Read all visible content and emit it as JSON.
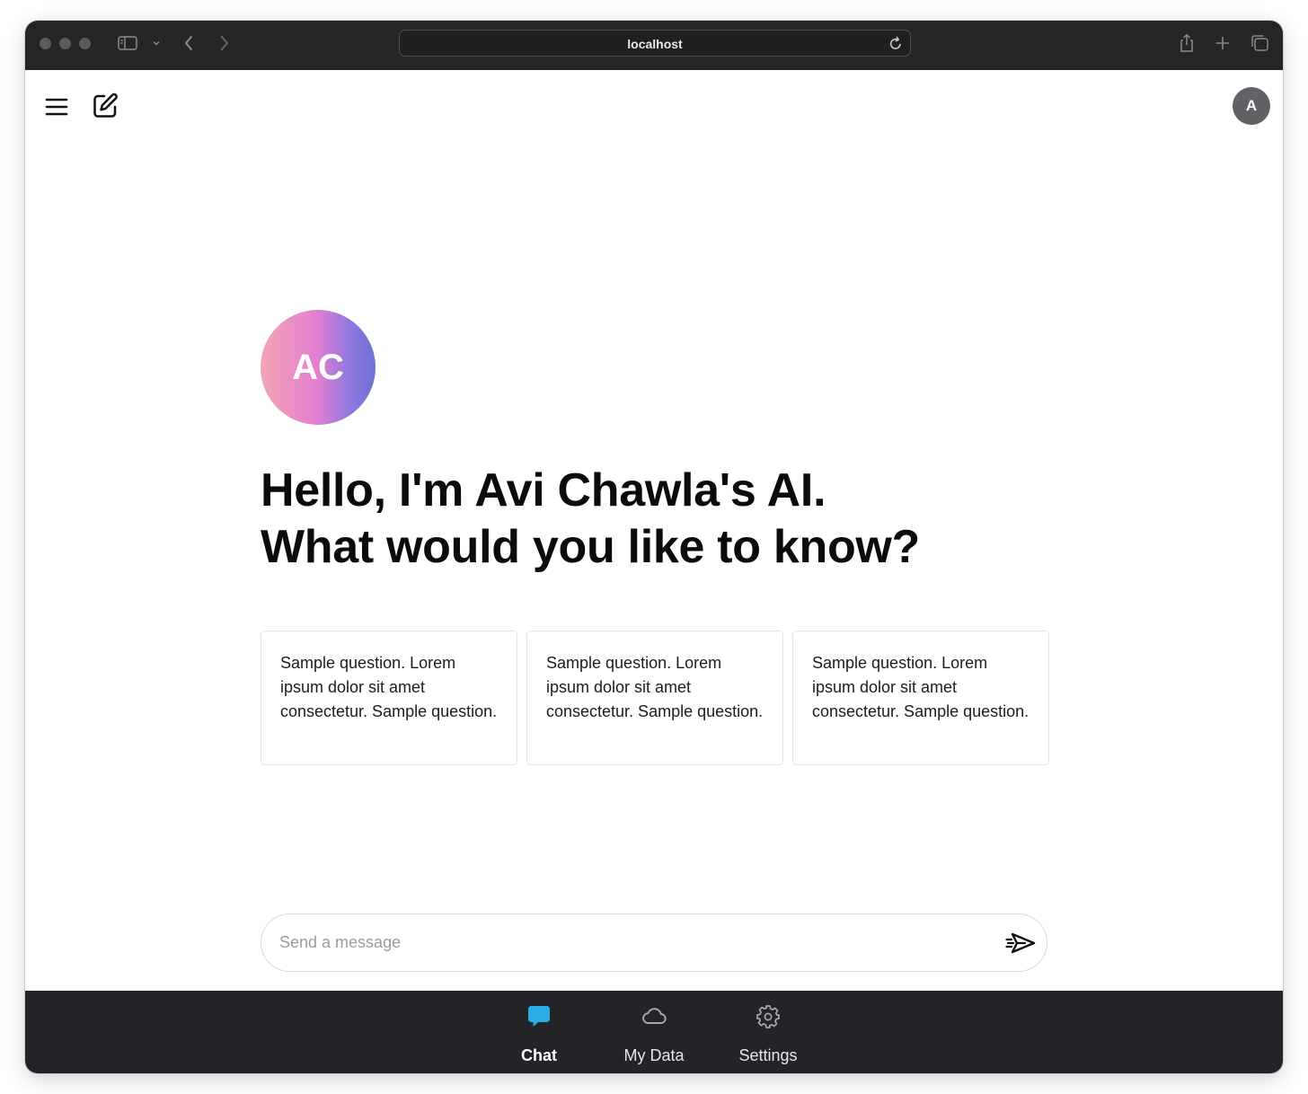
{
  "browser": {
    "url": "localhost"
  },
  "header": {
    "user_avatar_initial": "A"
  },
  "hero": {
    "avatar_initials": "AC",
    "greeting_line1": "Hello, I'm Avi Chawla's AI.",
    "greeting_line2": "What would you like to know?"
  },
  "sample_questions": [
    "Sample question. Lorem ipsum dolor sit amet consectetur. Sample question.",
    "Sample question. Lorem ipsum dolor sit amet consectetur. Sample question.",
    "Sample question. Lorem ipsum dolor sit amet consectetur. Sample question."
  ],
  "composer": {
    "placeholder": "Send a message"
  },
  "bottom_nav": {
    "items": [
      {
        "label": "Chat",
        "icon": "chat-bubble-icon",
        "active": true
      },
      {
        "label": "My Data",
        "icon": "cloud-icon",
        "active": false
      },
      {
        "label": "Settings",
        "icon": "gear-icon",
        "active": false
      }
    ]
  },
  "colors": {
    "chrome_background": "#242526",
    "nav_background": "#232427",
    "active_nav_icon": "#29aee8",
    "avatar_gradient": [
      "#f2a5b4",
      "#e47fd0",
      "#8f78df",
      "#6d72d6"
    ],
    "user_avatar": "#616266"
  }
}
